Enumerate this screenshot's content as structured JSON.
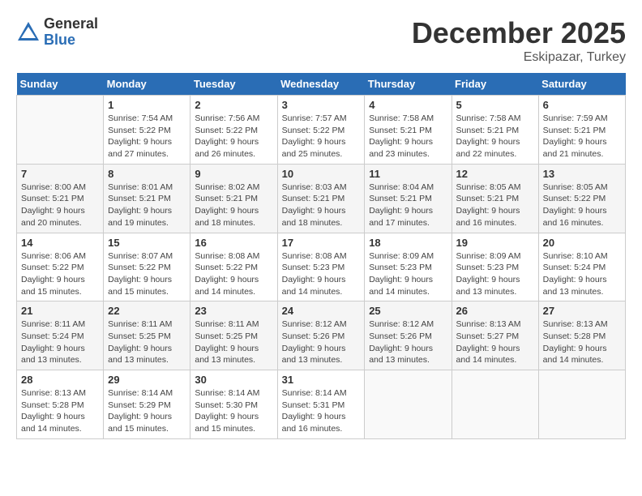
{
  "logo": {
    "general": "General",
    "blue": "Blue"
  },
  "header": {
    "month": "December 2025",
    "location": "Eskipazar, Turkey"
  },
  "weekdays": [
    "Sunday",
    "Monday",
    "Tuesday",
    "Wednesday",
    "Thursday",
    "Friday",
    "Saturday"
  ],
  "weeks": [
    [
      {
        "day": "",
        "info": ""
      },
      {
        "day": "1",
        "info": "Sunrise: 7:54 AM\nSunset: 5:22 PM\nDaylight: 9 hours\nand 27 minutes."
      },
      {
        "day": "2",
        "info": "Sunrise: 7:56 AM\nSunset: 5:22 PM\nDaylight: 9 hours\nand 26 minutes."
      },
      {
        "day": "3",
        "info": "Sunrise: 7:57 AM\nSunset: 5:22 PM\nDaylight: 9 hours\nand 25 minutes."
      },
      {
        "day": "4",
        "info": "Sunrise: 7:58 AM\nSunset: 5:21 PM\nDaylight: 9 hours\nand 23 minutes."
      },
      {
        "day": "5",
        "info": "Sunrise: 7:58 AM\nSunset: 5:21 PM\nDaylight: 9 hours\nand 22 minutes."
      },
      {
        "day": "6",
        "info": "Sunrise: 7:59 AM\nSunset: 5:21 PM\nDaylight: 9 hours\nand 21 minutes."
      }
    ],
    [
      {
        "day": "7",
        "info": ""
      },
      {
        "day": "8",
        "info": "Sunrise: 8:01 AM\nSunset: 5:21 PM\nDaylight: 9 hours\nand 19 minutes."
      },
      {
        "day": "9",
        "info": "Sunrise: 8:02 AM\nSunset: 5:21 PM\nDaylight: 9 hours\nand 18 minutes."
      },
      {
        "day": "10",
        "info": "Sunrise: 8:03 AM\nSunset: 5:21 PM\nDaylight: 9 hours\nand 18 minutes."
      },
      {
        "day": "11",
        "info": "Sunrise: 8:04 AM\nSunset: 5:21 PM\nDaylight: 9 hours\nand 17 minutes."
      },
      {
        "day": "12",
        "info": "Sunrise: 8:05 AM\nSunset: 5:21 PM\nDaylight: 9 hours\nand 16 minutes."
      },
      {
        "day": "13",
        "info": "Sunrise: 8:05 AM\nSunset: 5:22 PM\nDaylight: 9 hours\nand 16 minutes."
      }
    ],
    [
      {
        "day": "14",
        "info": ""
      },
      {
        "day": "15",
        "info": "Sunrise: 8:07 AM\nSunset: 5:22 PM\nDaylight: 9 hours\nand 15 minutes."
      },
      {
        "day": "16",
        "info": "Sunrise: 8:08 AM\nSunset: 5:22 PM\nDaylight: 9 hours\nand 14 minutes."
      },
      {
        "day": "17",
        "info": "Sunrise: 8:08 AM\nSunset: 5:23 PM\nDaylight: 9 hours\nand 14 minutes."
      },
      {
        "day": "18",
        "info": "Sunrise: 8:09 AM\nSunset: 5:23 PM\nDaylight: 9 hours\nand 14 minutes."
      },
      {
        "day": "19",
        "info": "Sunrise: 8:09 AM\nSunset: 5:23 PM\nDaylight: 9 hours\nand 13 minutes."
      },
      {
        "day": "20",
        "info": "Sunrise: 8:10 AM\nSunset: 5:24 PM\nDaylight: 9 hours\nand 13 minutes."
      }
    ],
    [
      {
        "day": "21",
        "info": "Sunrise: 8:11 AM\nSunset: 5:24 PM\nDaylight: 9 hours\nand 13 minutes."
      },
      {
        "day": "22",
        "info": "Sunrise: 8:11 AM\nSunset: 5:25 PM\nDaylight: 9 hours\nand 13 minutes."
      },
      {
        "day": "23",
        "info": "Sunrise: 8:11 AM\nSunset: 5:25 PM\nDaylight: 9 hours\nand 13 minutes."
      },
      {
        "day": "24",
        "info": "Sunrise: 8:12 AM\nSunset: 5:26 PM\nDaylight: 9 hours\nand 13 minutes."
      },
      {
        "day": "25",
        "info": "Sunrise: 8:12 AM\nSunset: 5:26 PM\nDaylight: 9 hours\nand 13 minutes."
      },
      {
        "day": "26",
        "info": "Sunrise: 8:13 AM\nSunset: 5:27 PM\nDaylight: 9 hours\nand 14 minutes."
      },
      {
        "day": "27",
        "info": "Sunrise: 8:13 AM\nSunset: 5:28 PM\nDaylight: 9 hours\nand 14 minutes."
      }
    ],
    [
      {
        "day": "28",
        "info": "Sunrise: 8:13 AM\nSunset: 5:28 PM\nDaylight: 9 hours\nand 14 minutes."
      },
      {
        "day": "29",
        "info": "Sunrise: 8:14 AM\nSunset: 5:29 PM\nDaylight: 9 hours\nand 15 minutes."
      },
      {
        "day": "30",
        "info": "Sunrise: 8:14 AM\nSunset: 5:30 PM\nDaylight: 9 hours\nand 15 minutes."
      },
      {
        "day": "31",
        "info": "Sunrise: 8:14 AM\nSunset: 5:31 PM\nDaylight: 9 hours\nand 16 minutes."
      },
      {
        "day": "",
        "info": ""
      },
      {
        "day": "",
        "info": ""
      },
      {
        "day": "",
        "info": ""
      }
    ]
  ],
  "week7_sunday": "Sunrise: 8:00 AM\nSunset: 5:21 PM\nDaylight: 9 hours\nand 20 minutes.",
  "week14_sunday": "Sunrise: 8:06 AM\nSunset: 5:22 PM\nDaylight: 9 hours\nand 15 minutes."
}
